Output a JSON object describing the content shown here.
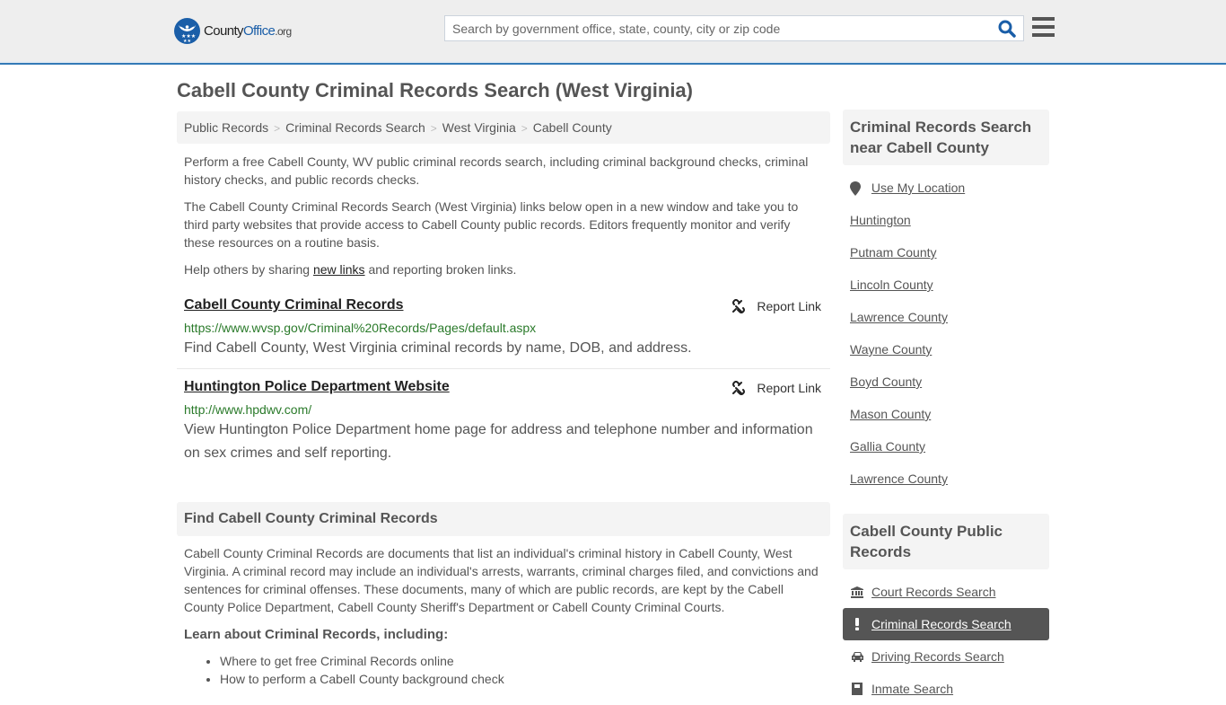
{
  "header": {
    "logo": {
      "prefix": "County",
      "brand": "Office",
      "tld": ".org"
    },
    "search": {
      "placeholder": "Search by government office, state, county, city or zip code",
      "value": ""
    },
    "colors": {
      "brand_blue": "#1a5ea8",
      "accent_border": "#337ab7"
    }
  },
  "page": {
    "title": "Cabell County Criminal Records Search (West Virginia)",
    "breadcrumb": [
      {
        "label": "Public Records"
      },
      {
        "label": "Criminal Records Search"
      },
      {
        "label": "West Virginia"
      },
      {
        "label": "Cabell County"
      }
    ],
    "breadcrumb_sep": ">",
    "intro": {
      "p1": "Perform a free Cabell County, WV public criminal records search, including criminal background checks, criminal history checks, and public records checks.",
      "p2": "The Cabell County Criminal Records Search (West Virginia) links below open in a new window and take you to third party websites that provide access to Cabell County public records. Editors frequently monitor and verify these resources on a routine basis.",
      "p3_before": "Help others by sharing ",
      "p3_link": "new links",
      "p3_after": " and reporting broken links."
    },
    "results": [
      {
        "title": "Cabell County Criminal Records",
        "url": "https://www.wvsp.gov/Criminal%20Records/Pages/default.aspx",
        "description": "Find Cabell County, West Virginia criminal records by name, DOB, and address.",
        "report_label": "Report Link"
      },
      {
        "title": "Huntington Police Department Website",
        "url": "http://www.hpdwv.com/",
        "description": "View Huntington Police Department home page for address and telephone number and information on sex crimes and self reporting.",
        "report_label": "Report Link"
      }
    ],
    "find_section": {
      "heading": "Find Cabell County Criminal Records",
      "body": "Cabell County Criminal Records are documents that list an individual's criminal history in Cabell County, West Virginia. A criminal record may include an individual's arrests, warrants, criminal charges filed, and convictions and sentences for criminal offenses. These documents, many of which are public records, are kept by the Cabell County Police Department, Cabell County Sheriff's Department or Cabell County Criminal Courts.",
      "learn_heading": "Learn about Criminal Records, including:",
      "learn_items": [
        "Where to get free Criminal Records online",
        "How to perform a Cabell County background check"
      ]
    }
  },
  "sidebar": {
    "nearby": {
      "heading": "Criminal Records Search near Cabell County",
      "use_location": "Use My Location",
      "links": [
        "Huntington",
        "Putnam County",
        "Lincoln County",
        "Lawrence County",
        "Wayne County",
        "Boyd County",
        "Mason County",
        "Gallia County",
        "Lawrence County"
      ]
    },
    "public_records": {
      "heading": "Cabell County Public Records",
      "items": [
        {
          "label": "Court Records Search",
          "icon": "courthouse-icon",
          "active": false
        },
        {
          "label": "Criminal Records Search",
          "icon": "exclamation-icon",
          "active": true
        },
        {
          "label": "Driving Records Search",
          "icon": "car-icon",
          "active": false
        },
        {
          "label": "Inmate Search",
          "icon": "inmate-icon",
          "active": false
        }
      ]
    }
  }
}
